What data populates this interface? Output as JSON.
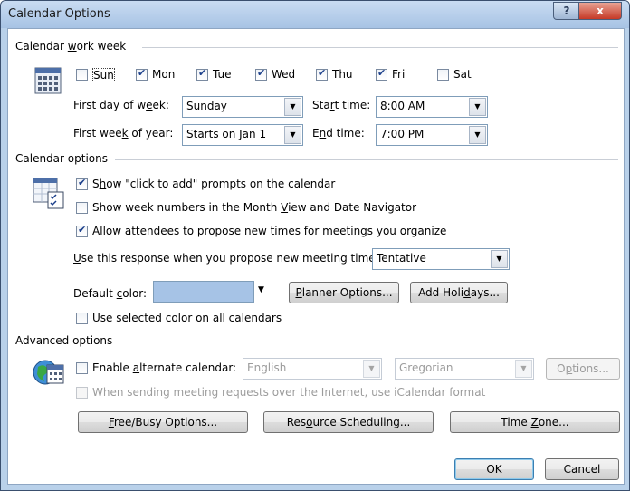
{
  "window": {
    "title": "Calendar Options",
    "help_glyph": "?",
    "close_glyph": "x"
  },
  "work_week": {
    "group_parts": [
      "Calendar ",
      "w",
      "ork week"
    ],
    "days": [
      {
        "label": "Sun",
        "checked": false
      },
      {
        "label": "Mon",
        "checked": true
      },
      {
        "label": "Tue",
        "checked": true
      },
      {
        "label": "Wed",
        "checked": true
      },
      {
        "label": "Thu",
        "checked": true
      },
      {
        "label": "Fri",
        "checked": true
      },
      {
        "label": "Sat",
        "checked": false
      }
    ],
    "first_day_label_parts": [
      "First day of w",
      "e",
      "ek:"
    ],
    "first_day_value": "Sunday",
    "start_time_label_parts": [
      "Sta",
      "r",
      "t time:"
    ],
    "start_time_value": "8:00 AM",
    "first_week_label_parts": [
      "First wee",
      "k",
      " of year:"
    ],
    "first_week_value": "Starts on Jan 1",
    "end_time_label_parts": [
      "E",
      "n",
      "d time:"
    ],
    "end_time_value": "7:00 PM"
  },
  "calendar_options": {
    "group_label": "Calendar options",
    "show_click_parts": [
      "S",
      "h",
      "ow \"click to add\" prompts on the calendar"
    ],
    "show_click_checked": true,
    "week_numbers_parts": [
      "Show week numbers in the Month ",
      "V",
      "iew and Date Navigator"
    ],
    "week_numbers_checked": false,
    "allow_propose_parts": [
      "A",
      "l",
      "low attendees to propose new times for meetings you organize"
    ],
    "allow_propose_checked": true,
    "response_label_parts": [
      "",
      "U",
      "se this response when you propose new meeting times:"
    ],
    "response_value": "Tentative",
    "default_color_label_parts": [
      "Default ",
      "c",
      "olor:"
    ],
    "default_color_hex": "#a6c3e6",
    "planner_button_parts": [
      "",
      "P",
      "lanner Options..."
    ],
    "holidays_button_parts": [
      "Add Holi",
      "d",
      "ays..."
    ],
    "use_color_parts": [
      "Use ",
      "s",
      "elected color on all calendars"
    ],
    "use_color_checked": false
  },
  "advanced": {
    "group_label": "Advanced options",
    "alt_cal_parts": [
      "Enable ",
      "a",
      "lternate calendar:"
    ],
    "alt_cal_checked": false,
    "language_value": "English",
    "calendar_type_value": "Gregorian",
    "options_button_parts": [
      "O",
      "p",
      "tions..."
    ],
    "icalendar_label": "When sending meeting requests over the Internet, use iCalendar format",
    "freebusy_button_parts": [
      "",
      "F",
      "ree/Busy Options..."
    ],
    "resource_button_parts": [
      "Res",
      "o",
      "urce Scheduling..."
    ],
    "timezone_button_parts": [
      "Time ",
      "Z",
      "one..."
    ]
  },
  "footer": {
    "ok_label": "OK",
    "cancel_label": "Cancel"
  }
}
